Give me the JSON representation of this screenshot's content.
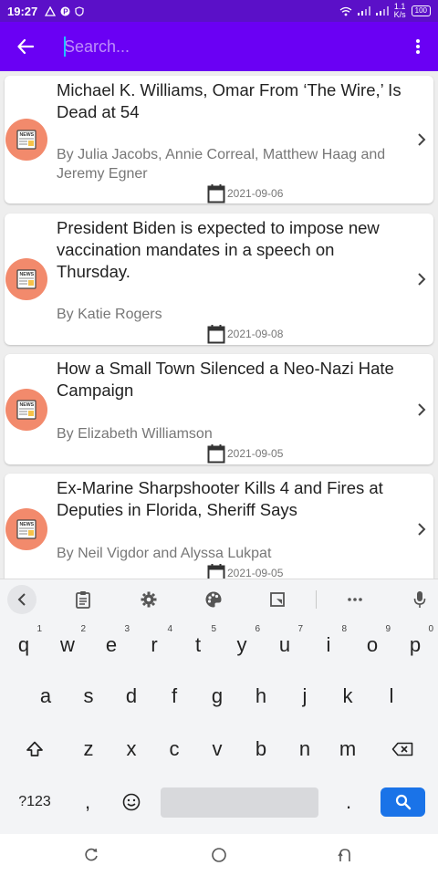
{
  "status_bar": {
    "time": "19:27",
    "net_speed_value": "1.1",
    "net_speed_unit": "K/s",
    "battery": "100"
  },
  "app_bar": {
    "search_placeholder": "Search...",
    "search_value": ""
  },
  "articles": [
    {
      "title": "Michael K. Williams, Omar From ‘The Wire,’ Is Dead at 54",
      "author": "By Julia Jacobs, Annie Correal, Matthew Haag and Jeremy Egner",
      "date": "2021-09-06"
    },
    {
      "title": "President Biden is expected to impose new vaccination mandates in a speech on Thursday.",
      "author": "By Katie Rogers",
      "date": "2021-09-08"
    },
    {
      "title": "How a Small Town Silenced a Neo-Nazi Hate Campaign",
      "author": "By Elizabeth Williamson",
      "date": "2021-09-05"
    },
    {
      "title": "Ex-Marine Sharpshooter Kills 4 and Fires at Deputies in Florida, Sheriff Says",
      "author": "By Neil Vigdor and Alyssa Lukpat",
      "date": "2021-09-05"
    }
  ],
  "keyboard": {
    "row1": [
      "q",
      "w",
      "e",
      "r",
      "t",
      "y",
      "u",
      "i",
      "o",
      "p"
    ],
    "row1_hints": [
      "1",
      "2",
      "3",
      "4",
      "5",
      "6",
      "7",
      "8",
      "9",
      "0"
    ],
    "row2": [
      "a",
      "s",
      "d",
      "f",
      "g",
      "h",
      "j",
      "k",
      "l"
    ],
    "row3": [
      "z",
      "x",
      "c",
      "v",
      "b",
      "n",
      "m"
    ],
    "symbols_key": "?123",
    "comma_key": ",",
    "period_key": "."
  },
  "colors": {
    "status_bar": "#5b10c8",
    "app_bar": "#6a00f4",
    "news_icon_bg": "#f28a6c",
    "search_key": "#1a73e8"
  }
}
